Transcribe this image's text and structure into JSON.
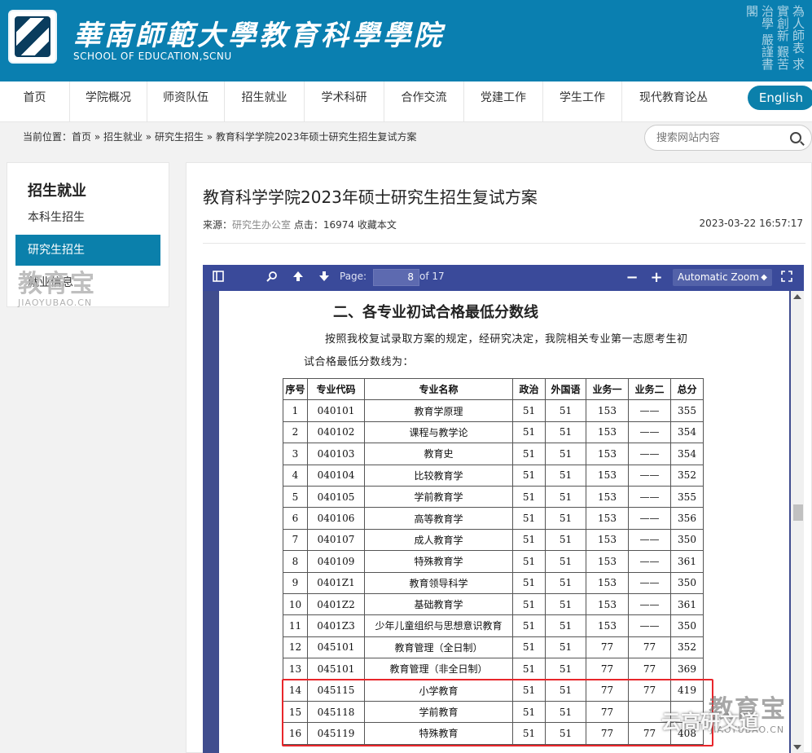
{
  "header": {
    "title": "華南師範大學教育科學學院",
    "subtitle": "SCHOOL OF EDUCATION,SCNU",
    "motto": "為人師表 求實創新 艱苦治學 嚴謹書閣",
    "brand_color": "#0a7fb0"
  },
  "nav": {
    "items": [
      "首页",
      "学院概况",
      "师资队伍",
      "招生就业",
      "学术科研",
      "合作交流",
      "党建工作",
      "学生工作",
      "现代教育论丛"
    ],
    "english_label": "English"
  },
  "breadcrumb": {
    "text": "当前位置：首页 » 招生就业 » 研究生招生 » 教育科学学院2023年硕士研究生招生复试方案"
  },
  "search": {
    "placeholder": "搜索网站内容"
  },
  "sidebar": {
    "title": "招生就业",
    "items": [
      "本科生招生",
      "研究生招生",
      "就业信息"
    ]
  },
  "article": {
    "title": "教育科学学院2023年硕士研究生招生复试方案",
    "source_label": "来源：",
    "source": "研究生办公室",
    "clicks_label": "点击：",
    "clicks": "16974",
    "favorite": "收藏本文",
    "date": "2023-03-22 16:57:17"
  },
  "pdf": {
    "page_label": "Page:",
    "page_current": "8",
    "page_total": "of 17",
    "zoom": "Automatic Zoom",
    "heading": "二、各专业初试合格最低分数线",
    "para1": "按照我校复试录取方案的规定，经研究决定，我院相关专业第一志愿考生初",
    "para2": "试合格最低分数线为：",
    "table": {
      "headers": [
        "序号",
        "专业代码",
        "专业名称",
        "政治",
        "外国语",
        "业务一",
        "业务二",
        "总分"
      ],
      "rows": [
        [
          "1",
          "040101",
          "教育学原理",
          "51",
          "51",
          "153",
          "——",
          "355"
        ],
        [
          "2",
          "040102",
          "课程与教学论",
          "51",
          "51",
          "153",
          "——",
          "354"
        ],
        [
          "3",
          "040103",
          "教育史",
          "51",
          "51",
          "153",
          "——",
          "354"
        ],
        [
          "4",
          "040104",
          "比较教育学",
          "51",
          "51",
          "153",
          "——",
          "352"
        ],
        [
          "5",
          "040105",
          "学前教育学",
          "51",
          "51",
          "153",
          "——",
          "355"
        ],
        [
          "6",
          "040106",
          "高等教育学",
          "51",
          "51",
          "153",
          "——",
          "356"
        ],
        [
          "7",
          "040107",
          "成人教育学",
          "51",
          "51",
          "153",
          "——",
          "350"
        ],
        [
          "8",
          "040109",
          "特殊教育学",
          "51",
          "51",
          "153",
          "——",
          "361"
        ],
        [
          "9",
          "0401Z1",
          "教育领导科学",
          "51",
          "51",
          "153",
          "——",
          "350"
        ],
        [
          "10",
          "0401Z2",
          "基础教育学",
          "51",
          "51",
          "153",
          "——",
          "361"
        ],
        [
          "11",
          "0401Z3",
          "少年儿童组织与思想意识教育",
          "51",
          "51",
          "153",
          "——",
          "350"
        ],
        [
          "12",
          "045101",
          "教育管理（全日制）",
          "51",
          "51",
          "77",
          "77",
          "352"
        ],
        [
          "13",
          "045101",
          "教育管理（非全日制）",
          "51",
          "51",
          "77",
          "77",
          "369"
        ],
        [
          "14",
          "045115",
          "小学教育",
          "51",
          "51",
          "77",
          "77",
          "419"
        ],
        [
          "15",
          "045118",
          "学前教育",
          "51",
          "51",
          "77",
          "",
          ""
        ],
        [
          "16",
          "045119",
          "特殊教育",
          "51",
          "51",
          "77",
          "77",
          "408"
        ]
      ]
    }
  },
  "watermarks": {
    "wm_main": "教育宝",
    "wm_sub": "JIAOYUBAO.CN",
    "wm_wechat": "云高研文道"
  }
}
